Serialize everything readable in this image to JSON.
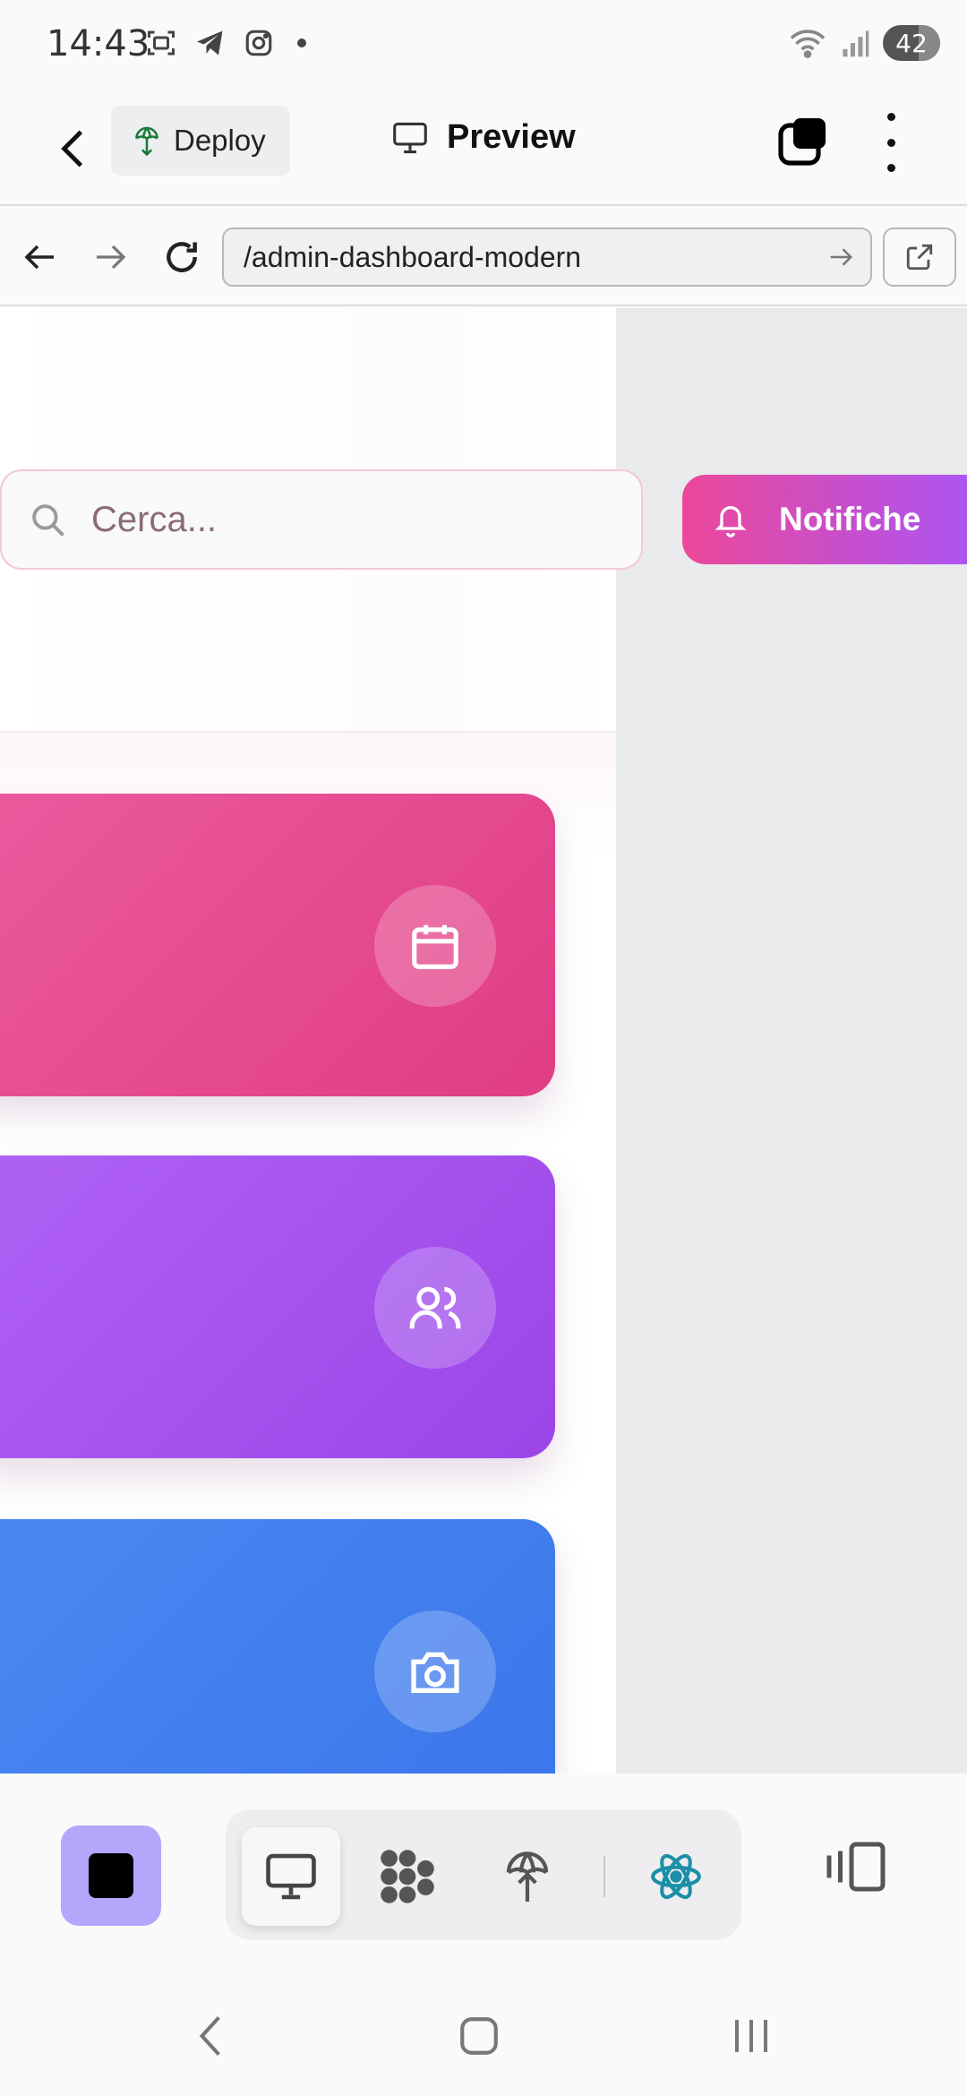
{
  "status_bar": {
    "time": "14:43",
    "battery": "42",
    "icons": [
      "screenshot-icon",
      "telegram-icon",
      "instagram-icon",
      "dot-icon",
      "wifi-icon",
      "signal-icon"
    ]
  },
  "app_header": {
    "deploy_label": "Deploy",
    "title": "Preview"
  },
  "browser": {
    "url": "/admin-dashboard-modern"
  },
  "dashboard": {
    "search_placeholder": "Cerca...",
    "notifications_label": "Notifiche",
    "cards": [
      {
        "color": "#ec5a9e",
        "icon": "calendar-icon"
      },
      {
        "color": "#b062f5",
        "icon": "users-icon"
      },
      {
        "color": "#4a89f2",
        "icon": "camera-icon"
      }
    ]
  },
  "toolbar": {
    "items": [
      "stop-icon",
      "monitor-icon",
      "dots-icon",
      "deploy-icon",
      "react-icon",
      "split-view-icon"
    ],
    "active_item": "monitor-icon",
    "accent": "#b3a6fb"
  }
}
